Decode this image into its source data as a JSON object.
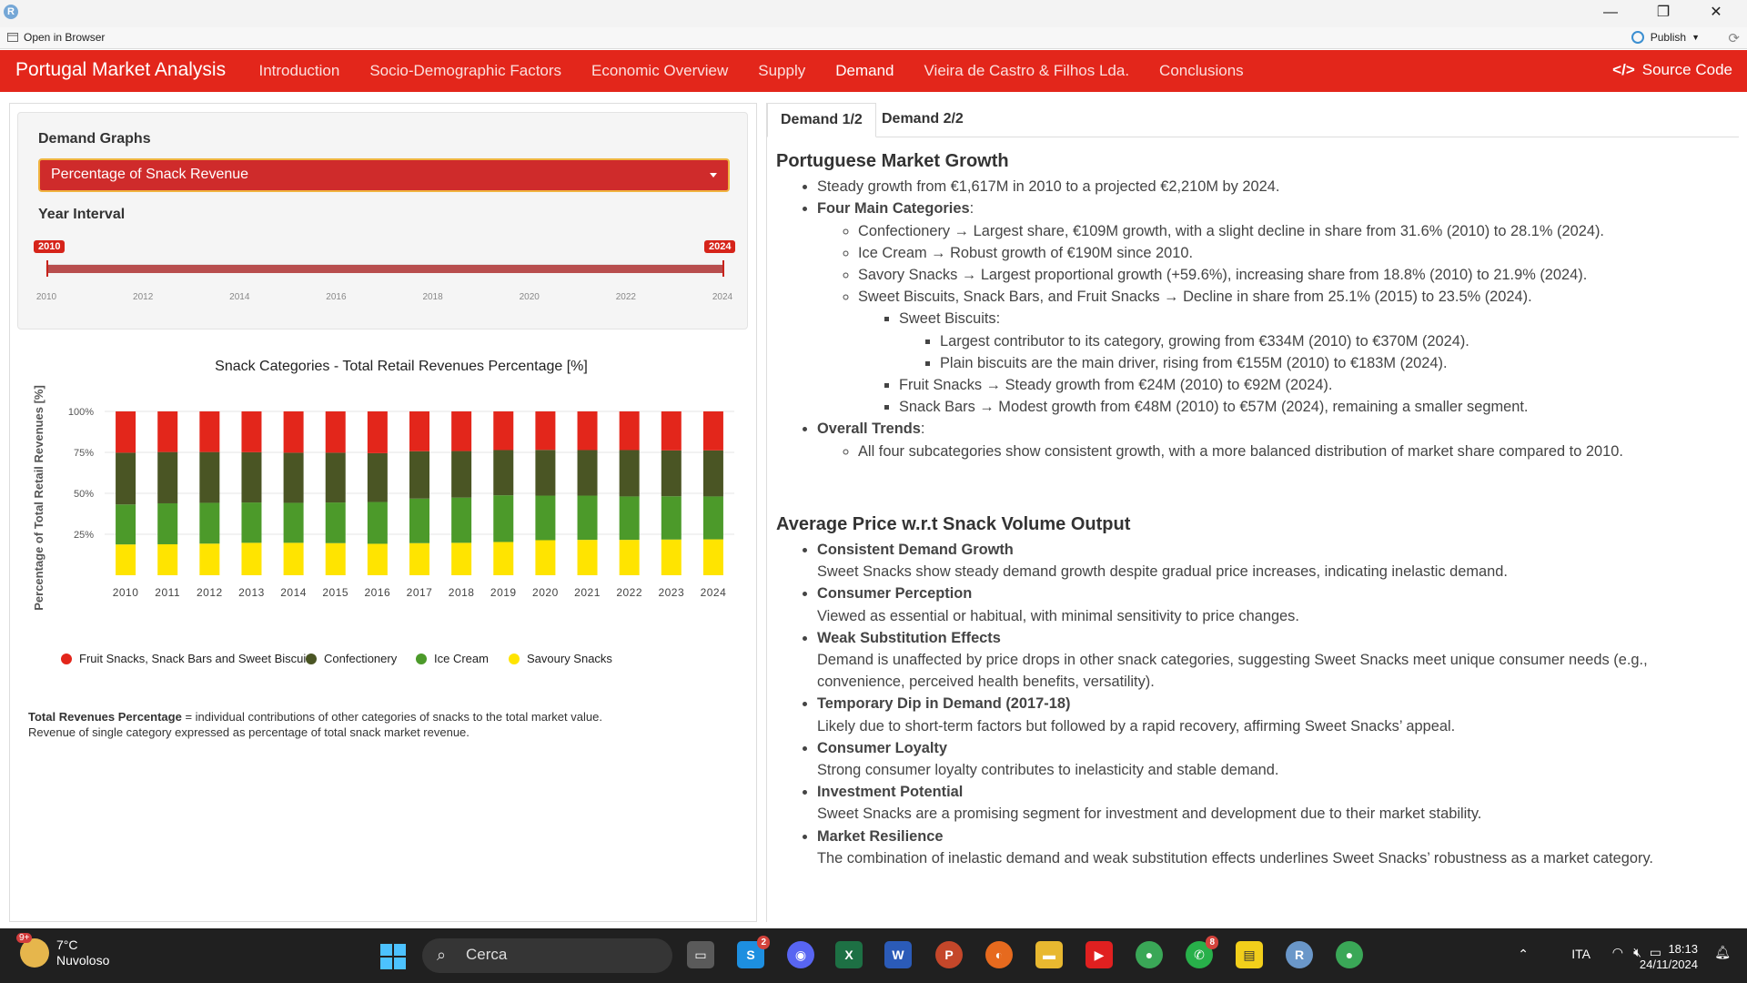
{
  "window": {
    "app_icon_letter": "R",
    "minimize": "—",
    "maximize": "❐",
    "close": "✕"
  },
  "rstudio": {
    "open_browser": "Open in Browser",
    "publish": "Publish"
  },
  "nav": {
    "brand": "Portugal Market Analysis",
    "items": [
      "Introduction",
      "Socio-Demographic Factors",
      "Economic Overview",
      "Supply",
      "Demand",
      "Vieira de Castro & Filhos Lda.",
      "Conclusions"
    ],
    "active": "Demand",
    "source_code": "Source Code"
  },
  "controls": {
    "demand_graphs_label": "Demand Graphs",
    "demand_graphs_value": "Percentage of Snack Revenue",
    "year_interval_label": "Year Interval",
    "slider_min": "2010",
    "slider_max": "2024",
    "slider_ticks": [
      "2010",
      "2012",
      "2014",
      "2016",
      "2018",
      "2020",
      "2022",
      "2024"
    ]
  },
  "chart_data": {
    "type": "bar",
    "stacked": true,
    "title": "Snack Categories - Total Retail Revenues Percentage [%]",
    "ylabel": "Percentage of Total Retail Revenues [%]",
    "xlabel": "",
    "ylim": [
      0,
      100
    ],
    "yticks": [
      "25%",
      "50%",
      "75%",
      "100%"
    ],
    "categories": [
      "2010",
      "2011",
      "2012",
      "2013",
      "2014",
      "2015",
      "2016",
      "2017",
      "2018",
      "2019",
      "2020",
      "2021",
      "2022",
      "2023",
      "2024"
    ],
    "series": [
      {
        "name": "Savoury Snacks",
        "color": "#ffe400",
        "values": [
          18.8,
          18.9,
          19.3,
          19.8,
          19.8,
          19.6,
          19.2,
          19.6,
          19.8,
          20.3,
          21.4,
          21.6,
          21.6,
          21.8,
          21.9
        ]
      },
      {
        "name": "Ice Cream",
        "color": "#4c9a2a",
        "values": [
          24.4,
          25.0,
          24.9,
          24.6,
          24.4,
          24.8,
          25.5,
          27.2,
          27.6,
          28.5,
          27.2,
          27.0,
          26.5,
          26.4,
          26.2
        ]
      },
      {
        "name": "Confectionery",
        "color": "#4a5524",
        "values": [
          31.6,
          31.3,
          31.0,
          30.7,
          30.6,
          30.4,
          29.8,
          28.9,
          28.4,
          27.6,
          27.9,
          27.8,
          28.3,
          28.0,
          28.1
        ]
      },
      {
        "name": "Fruit Snacks, Snack Bars and Sweet Biscuits",
        "color": "#e3261b",
        "values": [
          25.2,
          24.8,
          24.8,
          24.9,
          25.2,
          25.2,
          25.5,
          24.3,
          24.2,
          23.6,
          23.5,
          23.6,
          23.6,
          23.8,
          23.8
        ]
      }
    ],
    "legend_order": [
      "Fruit Snacks, Snack Bars and Sweet Biscuits",
      "Confectionery",
      "Ice Cream",
      "Savoury Snacks"
    ],
    "legend_position": "bottom",
    "grid": true
  },
  "footnote": {
    "term": "Total Revenues Percentage",
    "line1_rest": " = individual contributions of other categories of snacks to the total market value.",
    "line2": "Revenue of single category expressed as percentage of total snack market revenue."
  },
  "tabs": [
    "Demand 1/2",
    "Demand 2/2"
  ],
  "section1": {
    "title": "Portuguese Market Growth",
    "b1": "Steady growth from €1,617M in 2010 to a projected €2,210M by 2024.",
    "b2_title": "Four Main Categories",
    "b2_colon": ":",
    "c1": "Confectionery → Largest share, €109M growth, with a slight decline in share from 31.6% (2010) to 28.1% (2024).",
    "c2": "Ice Cream → Robust growth of €190M since 2010.",
    "c3": "Savory Snacks → Largest proportional growth (+59.6%), increasing share from 18.8% (2010) to 21.9% (2024).",
    "c4": "Sweet Biscuits, Snack Bars, and Fruit Snacks → Decline in share from 25.1% (2015) to 23.5% (2024).",
    "d1": "Sweet Biscuits:",
    "e1": "Largest contributor to its category, growing from €334M (2010) to €370M (2024).",
    "e2": "Plain biscuits are the main driver, rising from €155M (2010) to €183M (2024).",
    "d2": "Fruit Snacks → Steady growth from €24M (2010) to €92M (2024).",
    "d3": "Snack Bars → Modest growth from €48M (2010) to €57M (2024), remaining a smaller segment.",
    "b3_title": "Overall Trends",
    "b3_colon": ":",
    "f1": "All four subcategories show consistent growth, with a more balanced distribution of market share compared to 2010."
  },
  "section2": {
    "title": "Average Price w.r.t Snack Volume Output",
    "items": [
      {
        "title": "Consistent Demand Growth",
        "text": "Sweet Snacks show steady demand growth despite gradual price increases, indicating inelastic demand."
      },
      {
        "title": "Consumer Perception",
        "text": "Viewed as essential or habitual, with minimal sensitivity to price changes."
      },
      {
        "title": "Weak Substitution Effects",
        "text": "Demand is unaffected by price drops in other snack categories, suggesting Sweet Snacks meet unique consumer needs (e.g., convenience, perceived health benefits, versatility)."
      },
      {
        "title": "Temporary Dip in Demand (2017-18)",
        "text": "Likely due to short-term factors but followed by a rapid recovery, affirming Sweet Snacks’ appeal."
      },
      {
        "title": "Consumer Loyalty",
        "text": "Strong consumer loyalty contributes to inelasticity and stable demand."
      },
      {
        "title": "Investment Potential",
        "text": "Sweet Snacks are a promising segment for investment and development due to their market stability."
      },
      {
        "title": "Market Resilience",
        "text": "The combination of inelastic demand and weak substitution effects underlines Sweet Snacks’ robustness as a market category."
      }
    ]
  },
  "taskbar": {
    "weather_temp": "7°C",
    "weather_desc": "Nuvoloso",
    "weather_badge": "9+",
    "search": "Cerca",
    "skype_badge": "2",
    "whatsapp_badge": "8",
    "lang": "ITA",
    "time": "18:13",
    "date": "24/11/2024"
  }
}
